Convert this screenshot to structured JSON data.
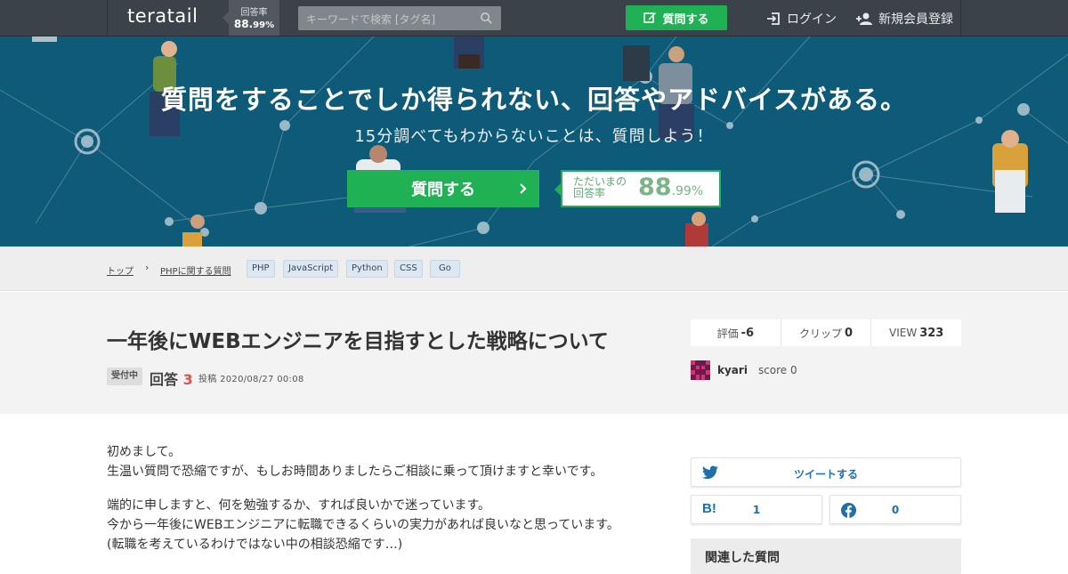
{
  "header": {
    "logo": "teratail",
    "rate_label": "回答率",
    "rate_main": "88.",
    "rate_decimal": "99%",
    "search_placeholder": "キーワードで検索 [タグ名]",
    "ask_label": "質問する",
    "login_label": "ログイン",
    "signup_label": "新規会員登録"
  },
  "hero": {
    "title": "質問をすることでしか得られない、回答やアドバイスがある。",
    "subtitle": "15分調べてもわからないことは、質問しよう！",
    "button_label": "質問する",
    "rate_label_1": "ただいまの",
    "rate_label_2": "回答率",
    "rate_main": "88",
    "rate_decimal": ".99%"
  },
  "breadcrumb": {
    "top": "トップ",
    "sep": "›",
    "category": "PHPに関する質問",
    "tags": [
      "PHP",
      "JavaScript",
      "Python",
      "CSS",
      "Go"
    ]
  },
  "question": {
    "title": "一年後にWEBエンジニアを目指すとした戦略について",
    "status": "受付中",
    "answers_label": "回答",
    "answers_count": "3",
    "posted": "投稿 2020/08/27 00:08",
    "stats": {
      "rating_label": "評価",
      "rating_value": "-6",
      "clip_label": "クリップ",
      "clip_value": "0",
      "view_label": "VIEW",
      "view_value": "323"
    },
    "author": {
      "name": "kyari",
      "score": "score 0"
    }
  },
  "body": {
    "p1_l1": "初めまして。",
    "p1_l2": "生温い質問で恐縮ですが、もしお時間ありましたらご相談に乗って頂けますと幸いです。",
    "p2_l1": "端的に申しますと、何を勉強するか、すれば良いかで迷っています。",
    "p2_l2": "今から一年後にWEBエンジニアに転職できるくらいの実力があれば良いなと思っています。",
    "p2_l3": "(転職を考えているわけではない中の相談恐縮です…)"
  },
  "sidebar": {
    "tweet_label": "ツイートする",
    "hatena_count": "1",
    "facebook_count": "0",
    "related_title": "関連した質問"
  },
  "colors": {
    "header_bg": "#3b4249",
    "accent_green": "#1fb154",
    "hero_bg": "#0e5a79",
    "answer_count": "#d9534f",
    "link_blue": "#1d6fae"
  }
}
